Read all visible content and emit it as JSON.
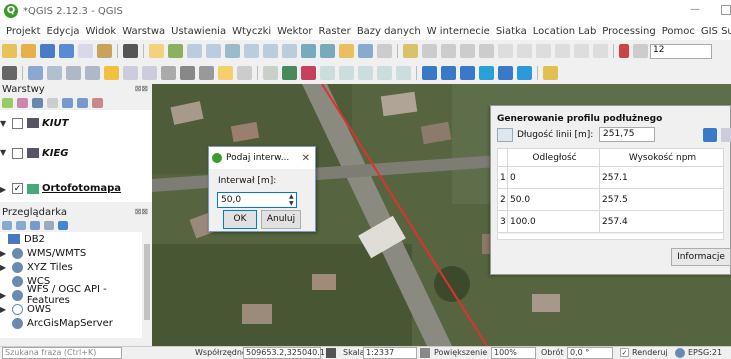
{
  "window": {
    "title": "*QGIS 2.12.3 - QGIS",
    "app_icon": "Q"
  },
  "menu": [
    "Projekt",
    "Edycja",
    "Widok",
    "Warstwa",
    "Ustawienia",
    "Wtyczki",
    "Wektor",
    "Raster",
    "Bazy danych",
    "W internecie",
    "Siatka",
    "Location Lab",
    "Processing",
    "Pomoc",
    "GIS Support"
  ],
  "toolbar": {
    "scale_field": "12"
  },
  "layers_panel": {
    "title": "Warstwy",
    "close": "⊠⊠",
    "layers": [
      {
        "name": "KIUT",
        "checked": false
      },
      {
        "name": "KIEG",
        "checked": false
      },
      {
        "name": "Ortofotomapa",
        "checked": true
      }
    ]
  },
  "browser_panel": {
    "title": "Przeglądarka",
    "items": [
      "DB2",
      "WMS/WMTS",
      "XYZ Tiles",
      "WCS",
      "WFS / OGC API - Features",
      "OWS",
      "ArcGisMapServer"
    ]
  },
  "dialog": {
    "title": "Podaj interw...",
    "label": "Interwał [m]:",
    "value": "50,0",
    "ok": "OK",
    "cancel": "Anuluj",
    "close": "✕"
  },
  "profile": {
    "title": "Generowanie profilu podłużnego",
    "length_label": "Długość linii [m]:",
    "length_value": "251,75",
    "col1": "Odległość",
    "col2": "Wysokość npm",
    "rows": [
      {
        "n": "1",
        "d": "0",
        "h": "257.1"
      },
      {
        "n": "2",
        "d": "50.0",
        "h": "257.5"
      },
      {
        "n": "3",
        "d": "100.0",
        "h": "257.4"
      }
    ],
    "info_button": "Informacje"
  },
  "status": {
    "search_placeholder": "Szukana fraza (Ctrl+K)",
    "coord_label": "Współrzędne",
    "coord_value": "509653.2,325040.1",
    "scale_label": "Skala",
    "scale_value": "1:2337",
    "zoom_label": "Powiększenie",
    "zoom_value": "100%",
    "rot_label": "Obrót",
    "rot_value": "0,0 °",
    "render_label": "Renderuj",
    "crs": "EPSG:21"
  }
}
